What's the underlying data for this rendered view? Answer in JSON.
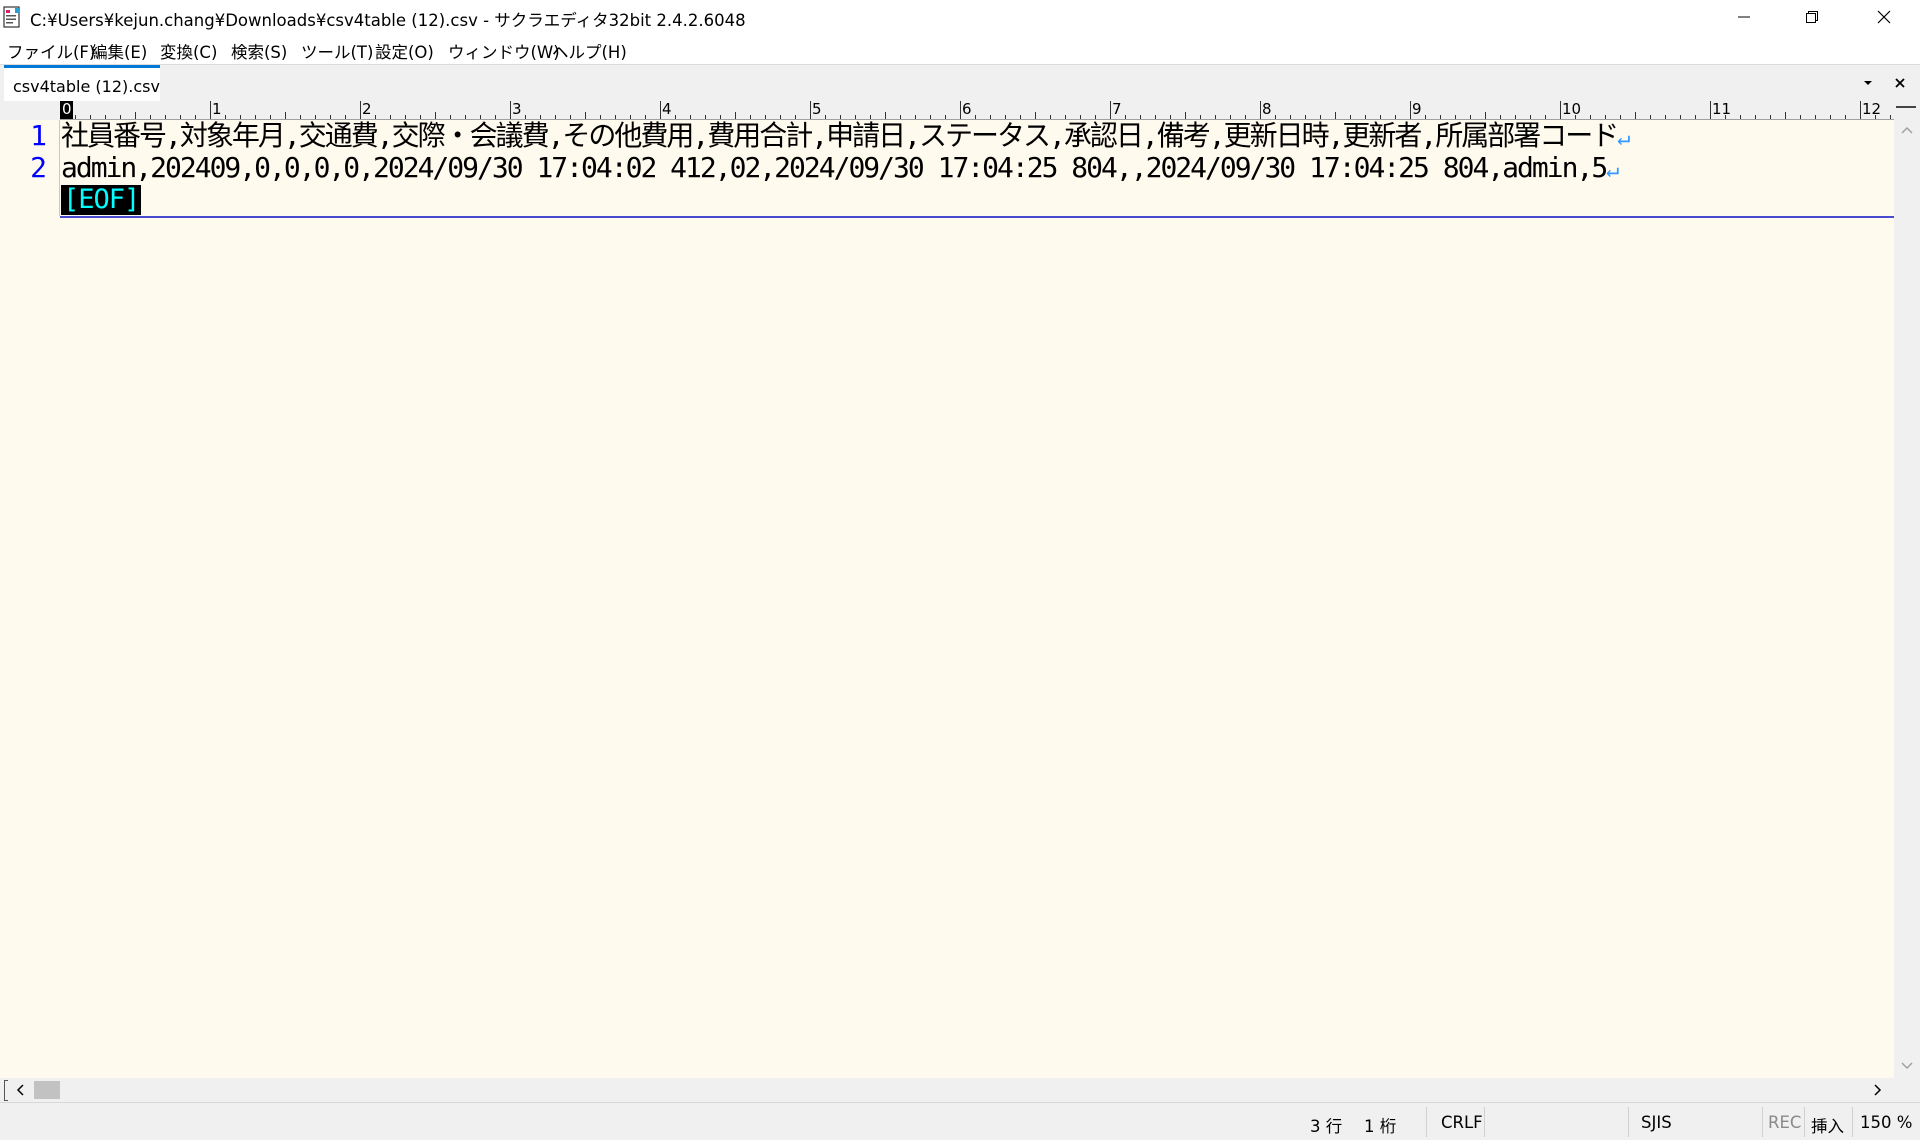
{
  "window": {
    "title": "C:¥Users¥kejun.chang¥Downloads¥csv4table (12).csv - サクラエディタ32bit 2.4.2.6048"
  },
  "menu": {
    "items": [
      "ファイル(F)",
      "編集(E)",
      "変換(C)",
      "検索(S)",
      "ツール(T)",
      "設定(O)",
      "ウィンドウ(W)",
      "ヘルプ(H)"
    ]
  },
  "tabs": {
    "active_label": "csv4table (12).csv"
  },
  "ruler": {
    "labels": [
      "0",
      "1",
      "2",
      "3",
      "4",
      "5",
      "6",
      "7",
      "8",
      "9",
      "10",
      "11",
      "12"
    ]
  },
  "editor": {
    "line_numbers": [
      "1",
      "2"
    ],
    "lines": [
      "社員番号,対象年月,交通費,交際・会議費,その他費用,費用合計,申請日,ステータス,承認日,備考,更新日時,更新者,所属部署コード",
      "admin,202409,0,0,0,0,2024/09/30 17:04:02 412,02,2024/09/30 17:04:25 804,,2024/09/30 17:04:25 804,admin,5"
    ],
    "eol_symbol": "↵",
    "eof_label": "[EOF]"
  },
  "status": {
    "line": "3 行",
    "column": "1 桁",
    "newline": "CRLF",
    "encoding": "SJIS",
    "rec": "REC",
    "mode": "挿入",
    "zoom": "150 %"
  },
  "colors": {
    "editor_bg": "#fffaee",
    "line_number": "#0000ff",
    "eol_mark": "#3399ff",
    "eof_fg": "#00ffff",
    "eof_bg": "#000000",
    "cursor_line": "#4a4ad0",
    "tab_accent": "#0078d7"
  },
  "icons": {
    "app": "sakura-editor-icon",
    "minimize": "minimize-icon",
    "maximize": "restore-icon",
    "close": "close-icon"
  }
}
